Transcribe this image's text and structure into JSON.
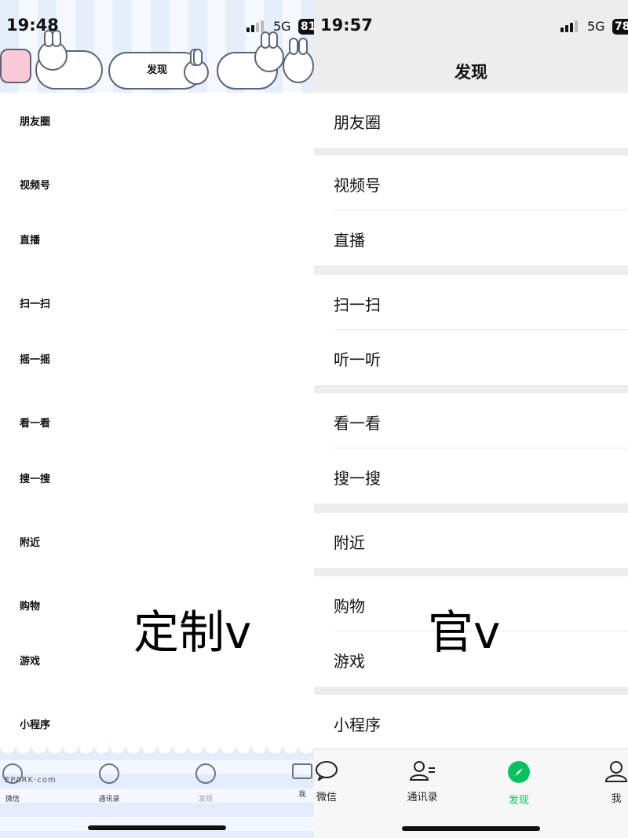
{
  "left": {
    "status": {
      "time": "19:48",
      "network": "5G",
      "battery": "81"
    },
    "title": "发现",
    "items": [
      "朋友圈",
      "视频号",
      "直播",
      "扫一扫",
      "摇一摇",
      "看一看",
      "搜一搜",
      "附近",
      "购物",
      "游戏",
      "小程序"
    ],
    "tabs": [
      "微信",
      "通讯录",
      "发现",
      "我"
    ],
    "watermark": "EPARK·com",
    "overlay_label": "定制v"
  },
  "right": {
    "status": {
      "time": "19:57",
      "network": "5G",
      "battery": "78"
    },
    "title": "发现",
    "items": [
      "朋友圈",
      "视频号",
      "直播",
      "扫一扫",
      "听一听",
      "看一看",
      "搜一搜",
      "附近",
      "购物",
      "游戏",
      "小程序"
    ],
    "tabs": [
      "微信",
      "通讯录",
      "发现",
      "我"
    ],
    "active_tab_color": "#07c160",
    "overlay_label": "官v"
  }
}
